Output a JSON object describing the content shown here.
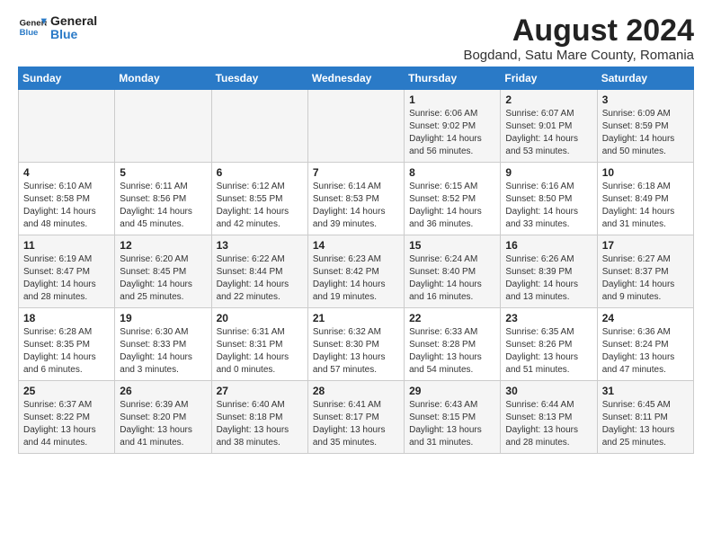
{
  "logo": {
    "line1": "General",
    "line2": "Blue"
  },
  "title": "August 2024",
  "subtitle": "Bogdand, Satu Mare County, Romania",
  "headers": [
    "Sunday",
    "Monday",
    "Tuesday",
    "Wednesday",
    "Thursday",
    "Friday",
    "Saturday"
  ],
  "weeks": [
    [
      {
        "day": "",
        "info": ""
      },
      {
        "day": "",
        "info": ""
      },
      {
        "day": "",
        "info": ""
      },
      {
        "day": "",
        "info": ""
      },
      {
        "day": "1",
        "info": "Sunrise: 6:06 AM\nSunset: 9:02 PM\nDaylight: 14 hours\nand 56 minutes."
      },
      {
        "day": "2",
        "info": "Sunrise: 6:07 AM\nSunset: 9:01 PM\nDaylight: 14 hours\nand 53 minutes."
      },
      {
        "day": "3",
        "info": "Sunrise: 6:09 AM\nSunset: 8:59 PM\nDaylight: 14 hours\nand 50 minutes."
      }
    ],
    [
      {
        "day": "4",
        "info": "Sunrise: 6:10 AM\nSunset: 8:58 PM\nDaylight: 14 hours\nand 48 minutes."
      },
      {
        "day": "5",
        "info": "Sunrise: 6:11 AM\nSunset: 8:56 PM\nDaylight: 14 hours\nand 45 minutes."
      },
      {
        "day": "6",
        "info": "Sunrise: 6:12 AM\nSunset: 8:55 PM\nDaylight: 14 hours\nand 42 minutes."
      },
      {
        "day": "7",
        "info": "Sunrise: 6:14 AM\nSunset: 8:53 PM\nDaylight: 14 hours\nand 39 minutes."
      },
      {
        "day": "8",
        "info": "Sunrise: 6:15 AM\nSunset: 8:52 PM\nDaylight: 14 hours\nand 36 minutes."
      },
      {
        "day": "9",
        "info": "Sunrise: 6:16 AM\nSunset: 8:50 PM\nDaylight: 14 hours\nand 33 minutes."
      },
      {
        "day": "10",
        "info": "Sunrise: 6:18 AM\nSunset: 8:49 PM\nDaylight: 14 hours\nand 31 minutes."
      }
    ],
    [
      {
        "day": "11",
        "info": "Sunrise: 6:19 AM\nSunset: 8:47 PM\nDaylight: 14 hours\nand 28 minutes."
      },
      {
        "day": "12",
        "info": "Sunrise: 6:20 AM\nSunset: 8:45 PM\nDaylight: 14 hours\nand 25 minutes."
      },
      {
        "day": "13",
        "info": "Sunrise: 6:22 AM\nSunset: 8:44 PM\nDaylight: 14 hours\nand 22 minutes."
      },
      {
        "day": "14",
        "info": "Sunrise: 6:23 AM\nSunset: 8:42 PM\nDaylight: 14 hours\nand 19 minutes."
      },
      {
        "day": "15",
        "info": "Sunrise: 6:24 AM\nSunset: 8:40 PM\nDaylight: 14 hours\nand 16 minutes."
      },
      {
        "day": "16",
        "info": "Sunrise: 6:26 AM\nSunset: 8:39 PM\nDaylight: 14 hours\nand 13 minutes."
      },
      {
        "day": "17",
        "info": "Sunrise: 6:27 AM\nSunset: 8:37 PM\nDaylight: 14 hours\nand 9 minutes."
      }
    ],
    [
      {
        "day": "18",
        "info": "Sunrise: 6:28 AM\nSunset: 8:35 PM\nDaylight: 14 hours\nand 6 minutes."
      },
      {
        "day": "19",
        "info": "Sunrise: 6:30 AM\nSunset: 8:33 PM\nDaylight: 14 hours\nand 3 minutes."
      },
      {
        "day": "20",
        "info": "Sunrise: 6:31 AM\nSunset: 8:31 PM\nDaylight: 14 hours\nand 0 minutes."
      },
      {
        "day": "21",
        "info": "Sunrise: 6:32 AM\nSunset: 8:30 PM\nDaylight: 13 hours\nand 57 minutes."
      },
      {
        "day": "22",
        "info": "Sunrise: 6:33 AM\nSunset: 8:28 PM\nDaylight: 13 hours\nand 54 minutes."
      },
      {
        "day": "23",
        "info": "Sunrise: 6:35 AM\nSunset: 8:26 PM\nDaylight: 13 hours\nand 51 minutes."
      },
      {
        "day": "24",
        "info": "Sunrise: 6:36 AM\nSunset: 8:24 PM\nDaylight: 13 hours\nand 47 minutes."
      }
    ],
    [
      {
        "day": "25",
        "info": "Sunrise: 6:37 AM\nSunset: 8:22 PM\nDaylight: 13 hours\nand 44 minutes."
      },
      {
        "day": "26",
        "info": "Sunrise: 6:39 AM\nSunset: 8:20 PM\nDaylight: 13 hours\nand 41 minutes."
      },
      {
        "day": "27",
        "info": "Sunrise: 6:40 AM\nSunset: 8:18 PM\nDaylight: 13 hours\nand 38 minutes."
      },
      {
        "day": "28",
        "info": "Sunrise: 6:41 AM\nSunset: 8:17 PM\nDaylight: 13 hours\nand 35 minutes."
      },
      {
        "day": "29",
        "info": "Sunrise: 6:43 AM\nSunset: 8:15 PM\nDaylight: 13 hours\nand 31 minutes."
      },
      {
        "day": "30",
        "info": "Sunrise: 6:44 AM\nSunset: 8:13 PM\nDaylight: 13 hours\nand 28 minutes."
      },
      {
        "day": "31",
        "info": "Sunrise: 6:45 AM\nSunset: 8:11 PM\nDaylight: 13 hours\nand 25 minutes."
      }
    ]
  ]
}
